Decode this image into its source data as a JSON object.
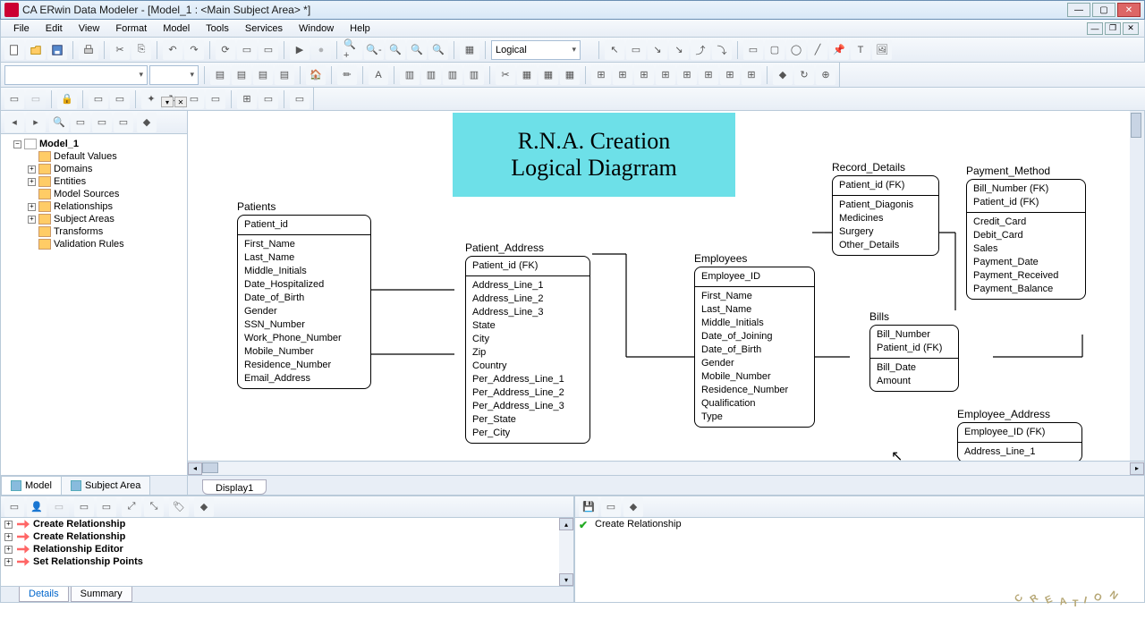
{
  "window": {
    "title": "CA ERwin Data Modeler - [Model_1 : <Main Subject Area> *]",
    "min": "—",
    "max": "▢",
    "close": "✕"
  },
  "menus": [
    "File",
    "Edit",
    "View",
    "Format",
    "Model",
    "Tools",
    "Services",
    "Window",
    "Help"
  ],
  "view_combo": "Logical",
  "tree": {
    "root": "Model_1",
    "items": [
      "Default Values",
      "Domains",
      "Entities",
      "Model Sources",
      "Relationships",
      "Subject Areas",
      "Transforms",
      "Validation Rules"
    ]
  },
  "side_tabs": {
    "model": "Model",
    "subject": "Subject Area"
  },
  "canvas_tab": "Display1",
  "diagram_title": "R.N.A. Creation\nLogical Diagrram",
  "entities": {
    "patients": {
      "name": "Patients",
      "pk": [
        "Patient_id"
      ],
      "attrs": [
        "First_Name",
        "Last_Name",
        "Middle_Initials",
        "Date_Hospitalized",
        "Date_of_Birth",
        "Gender",
        "SSN_Number",
        "Work_Phone_Number",
        "Mobile_Number",
        "Residence_Number",
        "Email_Address"
      ]
    },
    "patient_address": {
      "name": "Patient_Address",
      "pk": [
        "Patient_id (FK)"
      ],
      "attrs": [
        "Address_Line_1",
        "Address_Line_2",
        "Address_Line_3",
        "State",
        "City",
        "Zip",
        "Country",
        "Per_Address_Line_1",
        "Per_Address_Line_2",
        "Per_Address_Line_3",
        "Per_State",
        "Per_City"
      ]
    },
    "employees": {
      "name": "Employees",
      "pk": [
        "Employee_ID"
      ],
      "attrs": [
        "First_Name",
        "Last_Name",
        "Middle_Initials",
        "Date_of_Joining",
        "Date_of_Birth",
        "Gender",
        "Mobile_Number",
        "Residence_Number",
        "Qualification",
        "Type"
      ]
    },
    "record_details": {
      "name": "Record_Details",
      "pk": [
        "Patient_id (FK)"
      ],
      "attrs": [
        "Patient_Diagonis",
        "Medicines",
        "Surgery",
        "Other_Details"
      ]
    },
    "bills": {
      "name": "Bills",
      "pk": [
        "Bill_Number",
        "Patient_id (FK)"
      ],
      "attrs": [
        "Bill_Date",
        "Amount"
      ]
    },
    "payment_method": {
      "name": "Payment_Method",
      "pk": [
        "Bill_Number (FK)",
        "Patient_id (FK)"
      ],
      "attrs": [
        "Credit_Card",
        "Debit_Card",
        "Sales",
        "Payment_Date",
        "Payment_Received",
        "Payment_Balance"
      ]
    },
    "employee_address": {
      "name": "Employee_Address",
      "pk": [
        "Employee_ID (FK)"
      ],
      "attrs": [
        "Address_Line_1"
      ]
    }
  },
  "history": {
    "items": [
      "Create Relationship",
      "Create Relationship",
      "Relationship Editor",
      "Set Relationship Points"
    ]
  },
  "messages": {
    "item": "Create Relationship"
  },
  "footer_tabs": {
    "details": "Details",
    "summary": "Summary"
  },
  "watermark": "CREATION"
}
